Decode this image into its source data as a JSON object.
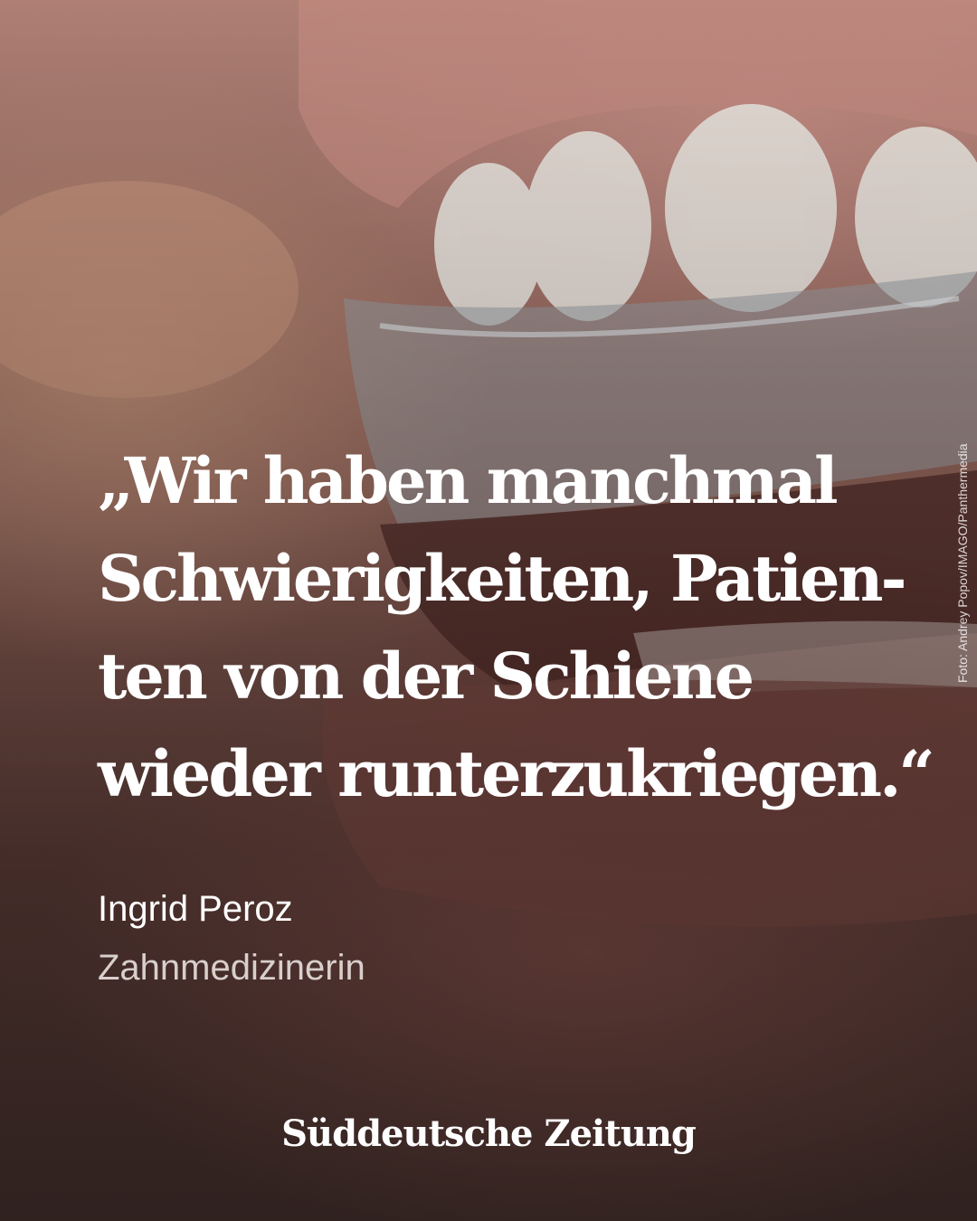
{
  "quote": {
    "lines": [
      "„Wir haben manchmal",
      "Schwierigkeiten, Patien-",
      "ten von der Schiene",
      "wieder runterzukriegen.“"
    ]
  },
  "attribution": {
    "name": "Ingrid Peroz",
    "role": "Zahnmedizinerin"
  },
  "photo_credit": "Foto: Andrey Popov/IMAGO/Panthermedia",
  "brand": {
    "logo_text": "Süddeutsche Zeitung"
  },
  "colors": {
    "text": "#ffffff",
    "role_text": "#d9cfcc"
  }
}
